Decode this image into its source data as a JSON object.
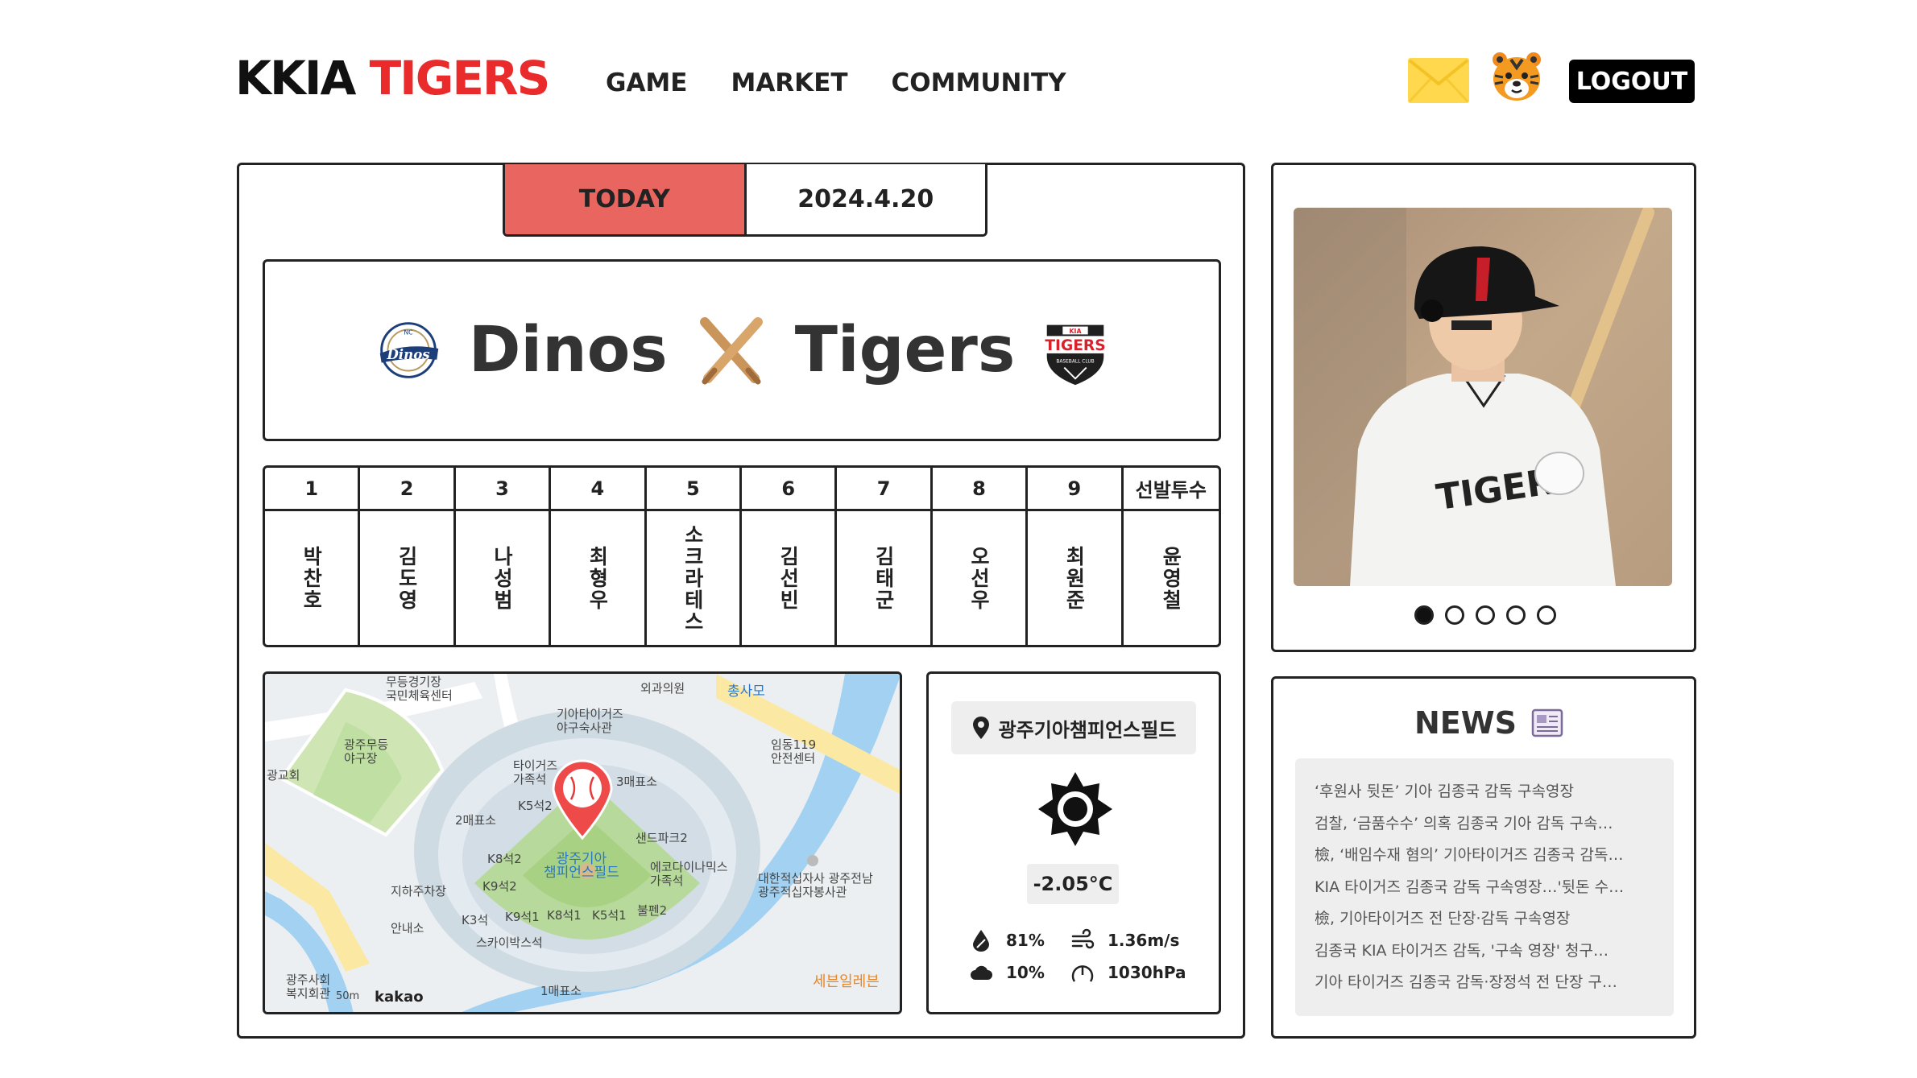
{
  "header": {
    "logo_prefix": "KKIA",
    "logo_suffix": "TIGERS",
    "nav": [
      "GAME",
      "MARKET",
      "COMMUNITY"
    ],
    "logout_label": "LOGOUT",
    "icons": [
      "envelope-icon",
      "tiger-avatar-icon"
    ]
  },
  "schedule": {
    "today_label": "TODAY",
    "date": "2024.4.20"
  },
  "match": {
    "home_team": "Dinos",
    "away_team": "Tigers",
    "vs_icon": "crossed-bats-icon"
  },
  "lineup": {
    "headers": [
      "1",
      "2",
      "3",
      "4",
      "5",
      "6",
      "7",
      "8",
      "9",
      "선발투수"
    ],
    "players": [
      "박찬호",
      "김도영",
      "나성범",
      "최형우",
      "소크라테스",
      "김선빈",
      "김태군",
      "오선우",
      "최원준",
      "윤영철"
    ]
  },
  "map": {
    "labels": {
      "l1": "무등경기장\n국민체육센터",
      "l2": "외과의원",
      "l3": "총사모",
      "l4": "기아타이거즈\n야구숙사관",
      "l5": "광주무등\n야구장",
      "l6": "광교회",
      "l7": "타이거즈\n가족석",
      "l8": "3매표소",
      "l9": "임동119\n안전센터",
      "l10": "K5석2",
      "l11": "2매표소",
      "l12": "K8석2",
      "l13": "광주기아\n챔피언스필드",
      "l14": "샌드파크2",
      "l15": "에코다이나믹스\n가족석",
      "l16": "K9석2",
      "l17": "지하주차장",
      "l18": "대한적십자사 광주전남\n광주적십자봉사관",
      "l19": "불펜2",
      "l20": "K3석",
      "l21": "K9석1",
      "l22": "K8석1",
      "l23": "K5석1",
      "l24": "안내소",
      "l25": "스카이박스석",
      "l26": "광주사회\n복지회관",
      "l27": "1매표소",
      "l28": "세븐일레븐",
      "scale": "50m"
    },
    "provider": "kakao"
  },
  "weather": {
    "location": "광주기아챔피언스필드",
    "condition_icon": "sun-icon",
    "temperature": "-2.05°C",
    "humidity": "81%",
    "wind": "1.36m/s",
    "cloud": "10%",
    "pressure": "1030hPa"
  },
  "carousel": {
    "slide_count": 5,
    "active_index": 0,
    "photo_label": "TIGERS"
  },
  "news": {
    "title": "NEWS",
    "items": [
      "‘후원사 뒷돈’ 기아 김종국 감독 구속영장",
      "검찰, ‘금품수수’ 의혹 김종국 기아 감독 구속…",
      "檢, ‘배임수재 혐의’ 기아타이거즈 김종국 감독…",
      "KIA 타이거즈 김종국 감독 구속영장…'뒷돈 수…",
      "檢, 기아타이거즈 전 단장·감독 구속영장",
      "김종국 KIA 타이거즈 감독, '구속 영장' 청구…",
      "기아 타이거즈 김종국 감독·장정석 전 단장 구…"
    ]
  }
}
